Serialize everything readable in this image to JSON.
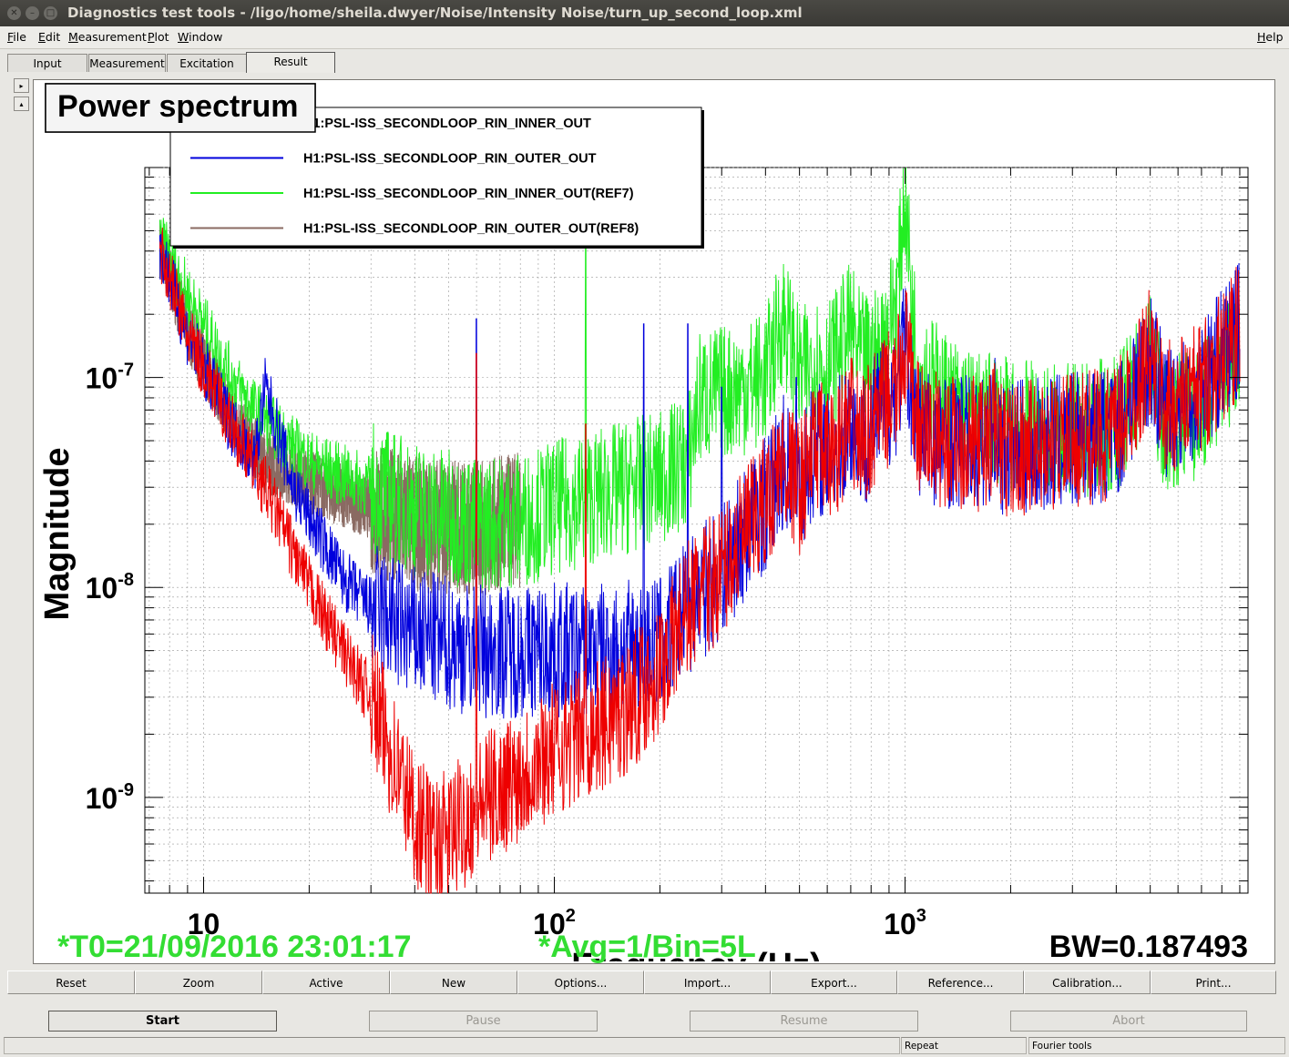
{
  "window": {
    "title": "Diagnostics test tools - /ligo/home/sheila.dwyer/Noise/Intensity Noise/turn_up_second_loop.xml",
    "close_glyph": "✕",
    "minimize_glyph": "–",
    "maximize_glyph": "□"
  },
  "menu": {
    "file": "File",
    "edit": "Edit",
    "measurement": "Measurement",
    "plot": "Plot",
    "window": "Window",
    "help": "Help"
  },
  "tabs": [
    "Input",
    "Measurement",
    "Excitation",
    "Result"
  ],
  "side_buttons": {
    "expand": "▸",
    "collapse": "▴"
  },
  "plot": {
    "title_box": "Power spectrum",
    "ylabel": "Magnitude",
    "xlabel": "Frequency (Hz)",
    "status_t0": "*T0=21/09/2016 23:01:17",
    "status_avg": "*Avg=1/Bin=5L",
    "status_bw": "BW=0.187493",
    "colors": {
      "green": "#22ee22",
      "blue": "#0000dd",
      "red": "#ee0000",
      "brown": "#8a6a62",
      "status_green": "#33dd33"
    }
  },
  "chart_data": {
    "type": "line",
    "title": "Power spectrum",
    "xlabel": "Frequency (Hz)",
    "ylabel": "Magnitude",
    "xscale": "log",
    "yscale": "log",
    "xlim": [
      7,
      900
    ],
    "ylim": [
      3.5e-10,
      1e-06
    ],
    "x_tick_labels": [
      "10",
      "10^2",
      "10^3"
    ],
    "y_tick_labels": [
      "10^-9",
      "10^-8",
      "10^-7"
    ],
    "grid": true,
    "legend_position": "top-left",
    "series": [
      {
        "name": "H1:PSL-ISS_SECONDLOOP_RIN_INNER_OUT",
        "color": "#ee0000",
        "points": [
          [
            7.5,
            4.2e-07
          ],
          [
            9,
            1.6e-07
          ],
          [
            12,
            6e-08
          ],
          [
            15,
            3e-08
          ],
          [
            20,
            1e-08
          ],
          [
            25,
            5e-09
          ],
          [
            30,
            3e-09
          ],
          [
            35,
            1.5e-09
          ],
          [
            40,
            8e-10
          ],
          [
            45,
            6e-10
          ],
          [
            50,
            6.5e-10
          ],
          [
            60,
            9e-10
          ],
          [
            80,
            1.3e-09
          ],
          [
            100,
            1.7e-09
          ],
          [
            150,
            2.4e-09
          ],
          [
            200,
            4e-09
          ],
          [
            240,
            8e-09
          ],
          [
            300,
            1.2e-08
          ],
          [
            400,
            2.5e-08
          ],
          [
            450,
            4e-08
          ],
          [
            500,
            3e-08
          ],
          [
            560,
            5e-08
          ],
          [
            600,
            4e-08
          ],
          [
            700,
            6e-08
          ],
          [
            760,
            5e-08
          ],
          [
            850,
            7e-08
          ],
          [
            950,
            9e-08
          ],
          [
            1000,
            1.5e-07
          ],
          [
            1050,
            8e-08
          ],
          [
            1100,
            5.5e-08
          ],
          [
            1300,
            5e-08
          ],
          [
            1700,
            4.8e-08
          ],
          [
            1800,
            6e-08
          ],
          [
            1900,
            4.5e-08
          ],
          [
            3000,
            5e-08
          ],
          [
            4000,
            5.5e-08
          ],
          [
            5000,
            1.3e-07
          ],
          [
            5500,
            7e-08
          ],
          [
            7000,
            9e-08
          ],
          [
            9000,
            1.7e-07
          ]
        ]
      },
      {
        "name": "H1:PSL-ISS_SECONDLOOP_RIN_OUTER_OUT",
        "color": "#0000dd",
        "points": [
          [
            7.5,
            4.2e-07
          ],
          [
            9,
            1.6e-07
          ],
          [
            12,
            6e-08
          ],
          [
            14,
            4e-08
          ],
          [
            15,
            9e-08
          ],
          [
            18,
            3e-08
          ],
          [
            25,
            1.1e-08
          ],
          [
            30,
            8e-09
          ],
          [
            40,
            6e-09
          ],
          [
            60,
            5e-09
          ],
          [
            100,
            5e-09
          ],
          [
            150,
            5e-09
          ],
          [
            200,
            5.5e-09
          ],
          [
            240,
            8e-09
          ],
          [
            300,
            1.2e-08
          ],
          [
            400,
            2.5e-08
          ],
          [
            450,
            4e-08
          ],
          [
            500,
            3e-08
          ],
          [
            560,
            5e-08
          ],
          [
            600,
            4e-08
          ],
          [
            700,
            6e-08
          ],
          [
            760,
            5e-08
          ],
          [
            850,
            7e-08
          ],
          [
            950,
            9e-08
          ],
          [
            1000,
            1.5e-07
          ],
          [
            1050,
            8e-08
          ],
          [
            1100,
            5.5e-08
          ],
          [
            1300,
            5e-08
          ],
          [
            1700,
            4.8e-08
          ],
          [
            1800,
            6e-08
          ],
          [
            1900,
            4.5e-08
          ],
          [
            3000,
            5e-08
          ],
          [
            4000,
            5.5e-08
          ],
          [
            5000,
            1.3e-07
          ],
          [
            5500,
            7e-08
          ],
          [
            7000,
            9e-08
          ],
          [
            9000,
            1.7e-07
          ]
        ]
      },
      {
        "name": "H1:PSL-ISS_SECONDLOOP_RIN_INNER_OUT(REF7)",
        "color": "#22ee22",
        "points": [
          [
            7.5,
            4.5e-07
          ],
          [
            9,
            2.5e-07
          ],
          [
            12,
            1e-07
          ],
          [
            14,
            7e-08
          ],
          [
            20,
            4e-08
          ],
          [
            30,
            3e-08
          ],
          [
            40,
            2.4e-08
          ],
          [
            60,
            2e-08
          ],
          [
            80,
            2.1e-08
          ],
          [
            100,
            2.4e-08
          ],
          [
            150,
            2.9e-08
          ],
          [
            200,
            3.3e-08
          ],
          [
            240,
            4e-08
          ],
          [
            260,
            8e-08
          ],
          [
            350,
            9e-08
          ],
          [
            400,
            1e-07
          ],
          [
            450,
            2e-07
          ],
          [
            500,
            1e-07
          ],
          [
            560,
            1.2e-07
          ],
          [
            600,
            1.1e-07
          ],
          [
            700,
            1.7e-07
          ],
          [
            750,
            1.2e-07
          ],
          [
            850,
            1.3e-07
          ],
          [
            950,
            2.5e-07
          ],
          [
            1000,
            8e-07
          ],
          [
            1050,
            2e-07
          ],
          [
            1100,
            1.1e-07
          ],
          [
            1300,
            8e-08
          ],
          [
            1700,
            6e-08
          ],
          [
            1800,
            7e-08
          ],
          [
            1900,
            6e-08
          ],
          [
            3000,
            5.5e-08
          ],
          [
            4000,
            6e-08
          ],
          [
            5000,
            1.2e-07
          ],
          [
            5500,
            6e-08
          ],
          [
            7000,
            7e-08
          ],
          [
            9000,
            1.5e-07
          ]
        ]
      },
      {
        "name": "H1:PSL-ISS_SECONDLOOP_RIN_OUTER_OUT(REF8)",
        "color": "#8a6a62",
        "points": [
          [
            7.5,
            4.2e-07
          ],
          [
            9,
            1.7e-07
          ],
          [
            12,
            6.5e-08
          ],
          [
            15,
            4e-08
          ],
          [
            20,
            3.2e-08
          ],
          [
            30,
            2.4e-08
          ],
          [
            40,
            2e-08
          ],
          [
            60,
            1.9e-08
          ],
          [
            80,
            2.1e-08
          ]
        ]
      }
    ]
  },
  "plot_buttons": [
    "Reset",
    "Zoom",
    "Active",
    "New",
    "Options...",
    "Import...",
    "Export...",
    "Reference...",
    "Calibration...",
    "Print..."
  ],
  "controls": {
    "start": "Start",
    "pause": "Pause",
    "resume": "Resume",
    "abort": "Abort"
  },
  "status": {
    "repeat": "Repeat",
    "fourier": "Fourier tools"
  }
}
